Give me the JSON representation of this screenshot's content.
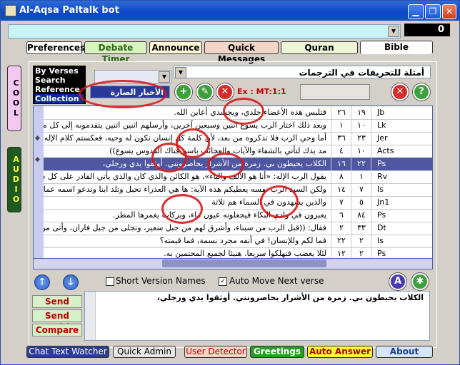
{
  "window": {
    "title": "Al-Aqsa Paltalk bot"
  },
  "counter": "0",
  "tabs": [
    "Preferences",
    "Debate Timer",
    "Announce",
    "Quick Messages",
    "Quran",
    "Bible"
  ],
  "side": {
    "cool": "COOL",
    "audio": "AUDIO"
  },
  "modes": [
    "By Verses",
    "Search",
    "Reference",
    "Collection"
  ],
  "collection_dropdown": "الأخبار الصارة",
  "topic_dropdown": "أمثلة للتحريفات في الترجمات",
  "reference_label": "Ex : MT:1:1",
  "rows": [
    {
      "book": "Jb",
      "ch": "١٩",
      "v": "٢٦",
      "text": "فتلبس هذه الأعضاء جلدي، ويجسدي أعاين الله."
    },
    {
      "book": "Lk",
      "ch": "١٠",
      "v": "١",
      "text": "وبعد ذلك اختار الرب يسوع اثنين وسبعين آخرين، وأرسلهم اثنين اثنين يتقدمونه إلى كل مدينة"
    },
    {
      "book": "Jer",
      "ch": "٢٣",
      "v": "٣٦",
      "text": "أما وحي الرب فلا تذكروه من بعد، لأن كلمة كل إنسان تكون له وحيه، فعكستم كلام الإله الحي و"
    },
    {
      "book": "Acts",
      "ch": "١٠",
      "v": "٤",
      "text": "مد يدك لتأتي بالشفاء والآيات والعجائب باسم فتاك القدوس يسوع))"
    },
    {
      "book": "Ps",
      "ch": "٢٢",
      "v": "١٦",
      "text": "الكلاب يحيطون بي. زمرة من الأشرار يحاصرونني. أوثقوا يدي ورجلي،"
    },
    {
      "book": "Rv",
      "ch": "١",
      "v": "٨",
      "text": "يقول الرب الإله: «أنا هو الألف والياء»، هو الكائن والذي كان والذي يأتي القادر على كل شيء"
    },
    {
      "book": "Is",
      "ch": "٧",
      "v": "١٤",
      "text": "ولكن السيد الرب نفسه يعطيكم هذه الآية: ها هي العذراء تحبل وتلد ابنا وتدعو اسمه عمانوئيل"
    },
    {
      "book": "Jn1",
      "ch": "٥",
      "v": "٧",
      "text": "والذين يشهدون في السماء هم ثلاثة"
    },
    {
      "book": "Ps",
      "ch": "٨٤",
      "v": "٦",
      "text": "يعبرون في وادي البكاء فيجعلونه عيون ماء، وبركات يغمرها المطر."
    },
    {
      "book": "Dt",
      "ch": "٣٣",
      "v": "٢",
      "text": "فقال: ((قبل الرب من سيناء، وأشرق لهم من جبل سعير، وتجلى من جبل فاران، وأتى من رب"
    },
    {
      "book": "Is",
      "ch": "٢",
      "v": "٢٢",
      "text": "فما لكم وللإنسان! في أنفه مجرد نسمة، فما قيمته؟"
    },
    {
      "book": "Ps",
      "ch": "٢",
      "v": "١٢",
      "text": "لئلا يغضب فتهلكوا سريعا. هنيئا لجميع المحتمين به."
    }
  ],
  "checkboxes": {
    "short_version": "Short Version Names",
    "auto_move": "Auto Move Next verse"
  },
  "send_buttons": [
    "Send",
    "Send Multi",
    "Compare"
  ],
  "message_text": "الكلاب يحيطون بي. زمرة من الأشرار يحاصرونني. أوثقوا يدي ورجلي،",
  "bottom_buttons": [
    "Chat Text Watcher",
    "Quick Admin",
    "User Detector",
    "Greetings",
    "Auto Answer",
    "About"
  ]
}
